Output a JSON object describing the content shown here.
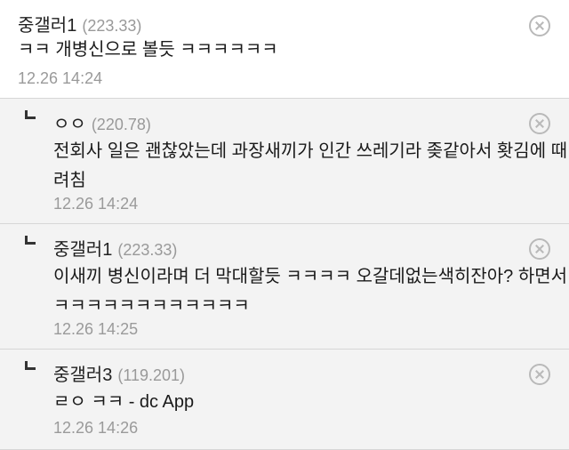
{
  "comments": [
    {
      "nickname": "중갤러1",
      "ip": "(223.33)",
      "text": "ㅋㅋ 개병신으로 볼듯 ㅋㅋㅋㅋㅋㅋ",
      "date": "12.26 14:24",
      "is_reply": false
    },
    {
      "nickname": "ㅇㅇ",
      "ip": "(220.78)",
      "text": "전회사 일은 괜찮았는데 과장새끼가 인간 쓰레기라 좆같아서 홧김에 때\n려침",
      "date": "12.26 14:24",
      "is_reply": true
    },
    {
      "nickname": "중갤러1",
      "ip": "(223.33)",
      "text": "이새끼 병신이라며 더 막대할듯 ㅋㅋㅋㅋ 오갈데없는색히잔아? 하면서\nㅋㅋㅋㅋㅋㅋㅋㅋㅋㅋㅋㅋ",
      "date": "12.26 14:25",
      "is_reply": true
    },
    {
      "nickname": "중갤러3",
      "ip": "(119.201)",
      "text": "ㄹㅇ ㅋㅋ - dc App",
      "date": "12.26 14:26",
      "is_reply": true
    }
  ],
  "icons": {
    "delete": "close-circle-icon",
    "reply": "reply-arrow-icon"
  },
  "colors": {
    "reply_background": "#f3f3f3",
    "ip_text": "#999999",
    "date_text": "#9a9a9a",
    "divider": "#d6d6d6"
  }
}
